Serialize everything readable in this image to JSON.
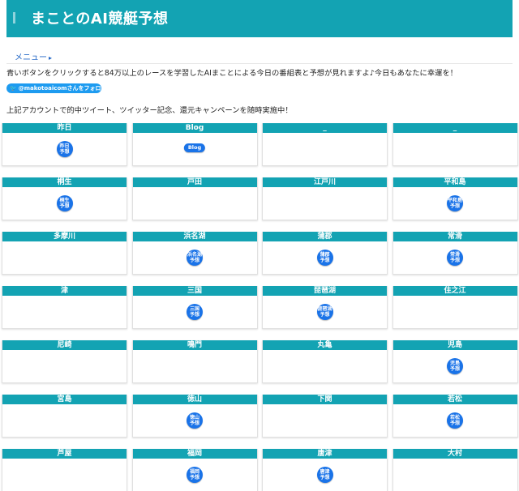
{
  "header": {
    "title": "まことのAI競艇予想"
  },
  "menu": {
    "label": "メニュー",
    "arrow": "▸"
  },
  "intro_text": "青いボタンをクリックすると84万以上のレースを学習したAIまことによる今日の番組表と予想が見れますよ♪今日もあなたに幸運を！",
  "follow_button": {
    "icon": "twitter-bird-icon",
    "label": "@makotoaicomさんをフォロー"
  },
  "note_text": "上記アカウントで的中ツイート、ツイッター記念、還元キャンペーンを随時実施中！",
  "colors": {
    "header": "#13a3b3",
    "badge": "#1a73e8",
    "twitter": "#1d9bf0",
    "link": "#2166c6"
  },
  "venues": [
    {
      "name": "昨日",
      "badge": "昨日\n予想"
    },
    {
      "name": "Blog",
      "badge": "Blog",
      "pill": true
    },
    {
      "name": "_",
      "badge": ""
    },
    {
      "name": "_",
      "badge": ""
    },
    {
      "name": "桐生",
      "badge": "桐生\n予想"
    },
    {
      "name": "戸田",
      "badge": ""
    },
    {
      "name": "江戸川",
      "badge": ""
    },
    {
      "name": "平和島",
      "badge": "平和島\n予想"
    },
    {
      "name": "多摩川",
      "badge": ""
    },
    {
      "name": "浜名湖",
      "badge": "浜名湖\n予想"
    },
    {
      "name": "蒲郡",
      "badge": "蒲郡\n予想"
    },
    {
      "name": "常滑",
      "badge": "常滑\n予想"
    },
    {
      "name": "津",
      "badge": ""
    },
    {
      "name": "三国",
      "badge": "三国\n予想"
    },
    {
      "name": "琵琶湖",
      "badge": "琵琶湖\n予想"
    },
    {
      "name": "住之江",
      "badge": ""
    },
    {
      "name": "尼崎",
      "badge": ""
    },
    {
      "name": "鳴門",
      "badge": ""
    },
    {
      "name": "丸亀",
      "badge": ""
    },
    {
      "name": "児島",
      "badge": "児島\n予想"
    },
    {
      "name": "宮島",
      "badge": ""
    },
    {
      "name": "徳山",
      "badge": "徳山\n予想"
    },
    {
      "name": "下関",
      "badge": ""
    },
    {
      "name": "若松",
      "badge": "若松\n予想"
    },
    {
      "name": "芦屋",
      "badge": ""
    },
    {
      "name": "福岡",
      "badge": "福岡\n予想"
    },
    {
      "name": "唐津",
      "badge": "唐津\n予想"
    },
    {
      "name": "大村",
      "badge": ""
    }
  ]
}
